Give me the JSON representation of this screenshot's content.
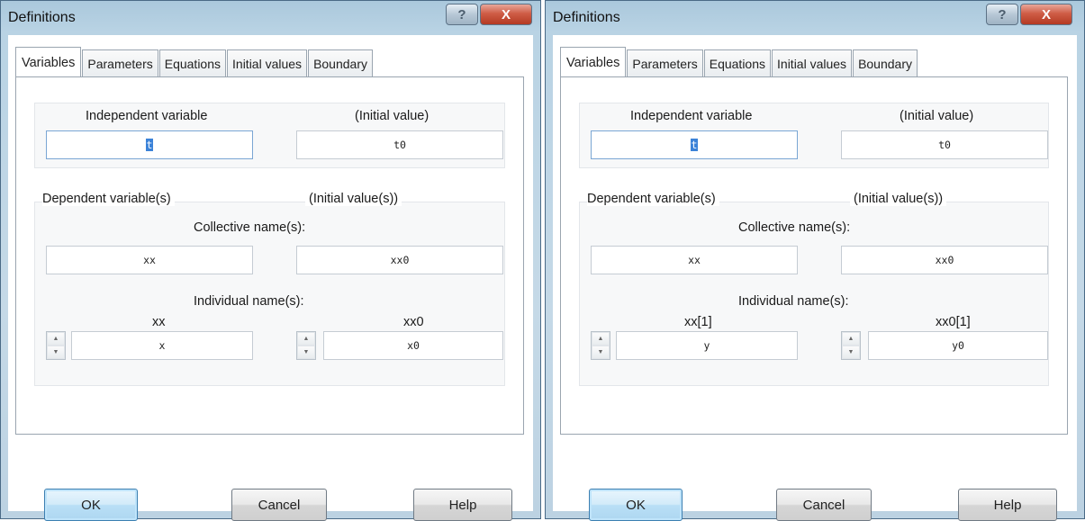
{
  "dialogs": [
    {
      "title": "Definitions",
      "titlebar": {
        "help_glyph": "?",
        "close_glyph": "X"
      },
      "tabs": [
        "Variables",
        "Parameters",
        "Equations",
        "Initial values",
        "Boundary"
      ],
      "active_tab": "Variables",
      "independent": {
        "label": "Independent variable",
        "initial_label": "(Initial value)",
        "value": "t",
        "initial_value": "t0"
      },
      "dependent": {
        "label": "Dependent variable(s)",
        "initial_label": "(Initial value(s))",
        "collective_label": "Collective name(s):",
        "collective_value": "xx",
        "collective_initial_value": "xx0",
        "individual_label": "Individual name(s):",
        "individual_var_label": "xx",
        "individual_var_value": "x",
        "individual_init_label": "xx0",
        "individual_init_value": "x0"
      },
      "buttons": {
        "ok": "OK",
        "cancel": "Cancel",
        "help": "Help"
      }
    },
    {
      "title": "Definitions",
      "titlebar": {
        "help_glyph": "?",
        "close_glyph": "X"
      },
      "tabs": [
        "Variables",
        "Parameters",
        "Equations",
        "Initial values",
        "Boundary"
      ],
      "active_tab": "Variables",
      "independent": {
        "label": "Independent variable",
        "initial_label": "(Initial value)",
        "value": "t",
        "initial_value": "t0"
      },
      "dependent": {
        "label": "Dependent variable(s)",
        "initial_label": "(Initial value(s))",
        "collective_label": "Collective name(s):",
        "collective_value": "xx",
        "collective_initial_value": "xx0",
        "individual_label": "Individual name(s):",
        "individual_var_label": "xx[1]",
        "individual_var_value": "y",
        "individual_init_label": "xx0[1]",
        "individual_init_value": "y0"
      },
      "buttons": {
        "ok": "OK",
        "cancel": "Cancel",
        "help": "Help"
      }
    }
  ],
  "icons": {
    "spin_up": "spin-up-arrow-icon",
    "spin_down": "spin-down-arrow-icon"
  },
  "colors": {
    "title_gradient": "#b9d3e4",
    "close_button": "#cf5d47",
    "default_button": "#b9dff6",
    "selection": "#3b82d8"
  }
}
